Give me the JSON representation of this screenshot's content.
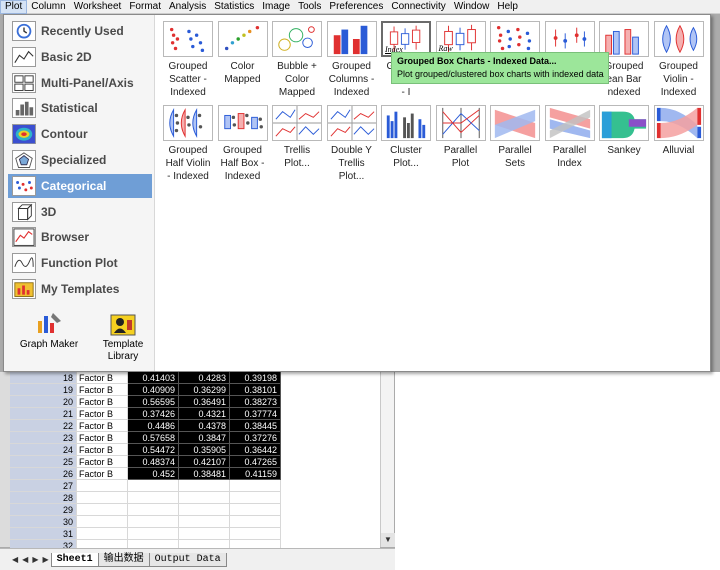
{
  "menu": [
    "Plot",
    "Column",
    "Worksheet",
    "Format",
    "Analysis",
    "Statistics",
    "Image",
    "Tools",
    "Preferences",
    "Connectivity",
    "Window",
    "Help"
  ],
  "categories": [
    {
      "label": "Recently Used",
      "icon": "clock-icon"
    },
    {
      "label": "Basic 2D",
      "icon": "line-chart-icon"
    },
    {
      "label": "Multi-Panel/Axis",
      "icon": "multi-panel-icon"
    },
    {
      "label": "Statistical",
      "icon": "histogram-icon"
    },
    {
      "label": "Contour",
      "icon": "contour-icon"
    },
    {
      "label": "Specialized",
      "icon": "radar-icon"
    },
    {
      "label": "Categorical",
      "icon": "categorical-icon"
    },
    {
      "label": "3D",
      "icon": "cube-icon"
    },
    {
      "label": "Browser",
      "icon": "browser-icon"
    },
    {
      "label": "Function Plot",
      "icon": "function-icon"
    },
    {
      "label": "My Templates",
      "icon": "templates-icon"
    }
  ],
  "tools": [
    {
      "label": "Graph Maker",
      "icon": "graph-maker-icon"
    },
    {
      "label": "Template\nLibrary",
      "icon": "template-library-icon"
    }
  ],
  "thumbs_row1": [
    {
      "caption": "Grouped\nScatter -\nIndexed",
      "kind": "scatter"
    },
    {
      "caption": "Color\nMapped",
      "kind": "colorpts"
    },
    {
      "caption": "Bubble +\nColor\nMapped",
      "kind": "bubble"
    },
    {
      "caption": "Grouped\nColumns -\nIndexed",
      "kind": "columns"
    },
    {
      "caption": "Grouped\nBo\n- I",
      "kind": "box-index",
      "badge": "Index"
    },
    {
      "caption": "Grouped",
      "kind": "box-raw",
      "badge": "Raw"
    },
    {
      "caption": "Grouped",
      "kind": "dots"
    },
    {
      "caption": "Grouped",
      "kind": "meanbar"
    },
    {
      "caption": "Grouped\nean Bar\nndexed",
      "kind": "meanbar2"
    },
    {
      "caption": "Grouped\nViolin -\nIndexed",
      "kind": "violin"
    }
  ],
  "thumbs_row2": [
    {
      "caption": "Grouped\nHalf Violin\n- Indexed",
      "kind": "halfviolin"
    },
    {
      "caption": "Grouped\nHalf Box -\nIndexed",
      "kind": "halfbox"
    },
    {
      "caption": "Trellis\nPlot...",
      "kind": "trellis"
    },
    {
      "caption": "Double Y\nTrellis\nPlot...",
      "kind": "trellis2"
    },
    {
      "caption": "Cluster\nPlot...",
      "kind": "cluster"
    },
    {
      "caption": "Parallel\nPlot",
      "kind": "parallel"
    },
    {
      "caption": "Parallel\nSets",
      "kind": "psets"
    },
    {
      "caption": "Parallel\nIndex",
      "kind": "pindex"
    },
    {
      "caption": "Sankey",
      "kind": "sankey"
    },
    {
      "caption": "Alluvial",
      "kind": "alluvial"
    }
  ],
  "tooltip": {
    "title": "Grouped Box Charts - Indexed Data...",
    "body": "Plot grouped/clustered box charts with indexed data"
  },
  "worksheet": {
    "rows": [
      {
        "n": "18",
        "cat": "Factor B",
        "a": "0.41403",
        "b": "0.4283",
        "c": "0.39198"
      },
      {
        "n": "19",
        "cat": "Factor B",
        "a": "0.40909",
        "b": "0.36299",
        "c": "0.38101"
      },
      {
        "n": "20",
        "cat": "Factor B",
        "a": "0.56595",
        "b": "0.36491",
        "c": "0.38273"
      },
      {
        "n": "21",
        "cat": "Factor B",
        "a": "0.37426",
        "b": "0.4321",
        "c": "0.37774"
      },
      {
        "n": "22",
        "cat": "Factor B",
        "a": "0.4486",
        "b": "0.4378",
        "c": "0.38445"
      },
      {
        "n": "23",
        "cat": "Factor B",
        "a": "0.57658",
        "b": "0.3847",
        "c": "0.37276"
      },
      {
        "n": "24",
        "cat": "Factor B",
        "a": "0.54472",
        "b": "0.35905",
        "c": "0.36442"
      },
      {
        "n": "25",
        "cat": "Factor B",
        "a": "0.48374",
        "b": "0.42107",
        "c": "0.47265"
      },
      {
        "n": "26",
        "cat": "Factor B",
        "a": "0.452",
        "b": "0.38481",
        "c": "0.41159"
      },
      {
        "n": "27",
        "cat": "",
        "a": "",
        "b": "",
        "c": ""
      },
      {
        "n": "28",
        "cat": "",
        "a": "",
        "b": "",
        "c": ""
      },
      {
        "n": "29",
        "cat": "",
        "a": "",
        "b": "",
        "c": ""
      },
      {
        "n": "30",
        "cat": "",
        "a": "",
        "b": "",
        "c": ""
      },
      {
        "n": "31",
        "cat": "",
        "a": "",
        "b": "",
        "c": ""
      },
      {
        "n": "32",
        "cat": "",
        "a": "",
        "b": "",
        "c": ""
      }
    ],
    "sheet_tabs": [
      "Sheet1",
      "输出数据",
      "Output Data"
    ]
  },
  "watermark": "知乎 @cumt-ting",
  "colors": {
    "selected_category": "#6f9ed6",
    "tooltip_bg": "#9ce69a",
    "red": "#e03030",
    "blue": "#2a5bd7"
  }
}
